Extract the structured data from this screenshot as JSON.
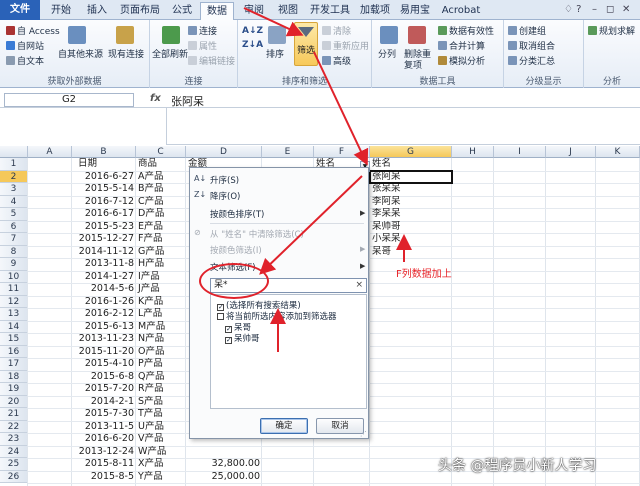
{
  "ribbon": {
    "tabs": [
      "文件",
      "开始",
      "插入",
      "页面布局",
      "公式",
      "数据",
      "审阅",
      "视图",
      "开发工具",
      "加载项",
      "易用宝",
      "Acrobat"
    ],
    "active_tab": "数据",
    "groups": {
      "external": {
        "label": "获取外部数据",
        "items": [
          "自 Access",
          "自网站",
          "自文本",
          "自其他来源",
          "现有连接"
        ]
      },
      "connections": {
        "label": "连接",
        "items": [
          "全部刷新",
          "连接",
          "属性",
          "编辑链接"
        ]
      },
      "sort_filter": {
        "label": "排序和筛选",
        "items": [
          "排序",
          "筛选",
          "清除",
          "重新应用",
          "高级"
        ]
      },
      "data_tools": {
        "label": "数据工具",
        "items": [
          "分列",
          "删除重复项",
          "数据有效性",
          "合并计算",
          "模拟分析"
        ]
      },
      "outline": {
        "label": "分级显示",
        "items": [
          "创建组",
          "取消组合",
          "分类汇总"
        ]
      },
      "analysis": {
        "label": "分析",
        "items": [
          "规划求解"
        ]
      }
    }
  },
  "formula_bar": {
    "name_box": "G2",
    "fx": "fx",
    "value": "张阿呆"
  },
  "sheet": {
    "columns": [
      "A",
      "B",
      "C",
      "D",
      "E",
      "F",
      "G",
      "H",
      "I",
      "J",
      "K"
    ],
    "selected_column": "G",
    "rows": [
      "1",
      "2",
      "3",
      "4",
      "5",
      "6",
      "7",
      "8",
      "9",
      "10",
      "11",
      "12",
      "13",
      "14",
      "15",
      "16",
      "17",
      "18",
      "19",
      "20",
      "21",
      "22",
      "23",
      "24",
      "25",
      "26"
    ],
    "selected_row": "2",
    "headers": {
      "date": "日期",
      "product": "商品",
      "amount": "金额",
      "name": "姓名",
      "gname": "姓名"
    },
    "dates": [
      "2016-6-27",
      "2015-5-14",
      "2016-7-12",
      "2016-6-17",
      "2015-5-23",
      "2015-12-27",
      "2014-11-12",
      "2013-11-8",
      "2014-1-27",
      "2014-5-6",
      "2016-1-26",
      "2016-2-12",
      "2015-6-13",
      "2013-11-23",
      "2015-11-20",
      "2015-4-10",
      "2015-6-8",
      "2015-7-20",
      "2014-2-1",
      "2015-7-30",
      "2013-11-5",
      "2016-6-20",
      "2013-12-24",
      "2015-8-11",
      "2015-8-5"
    ],
    "products": [
      "A产品",
      "B产品",
      "C产品",
      "D产品",
      "E产品",
      "F产品",
      "G产品",
      "H产品",
      "I产品",
      "J产品",
      "K产品",
      "L产品",
      "M产品",
      "N产品",
      "O产品",
      "P产品",
      "Q产品",
      "R产品",
      "S产品",
      "T产品",
      "U产品",
      "V产品",
      "W产品",
      "X产品",
      "Y产品"
    ],
    "amounts_visible": [
      "32,800.00",
      "25,000.00"
    ],
    "g_names": [
      "张阿呆",
      "张呆呆",
      "李阿呆",
      "李呆呆",
      "呆帅哥",
      "小呆呆",
      "呆哥"
    ]
  },
  "filter_menu": {
    "sort_asc": "升序(S)",
    "sort_desc": "降序(O)",
    "sort_color": "按颜色排序(T)",
    "clear_filter": "从 \"姓名\" 中清除筛选(C)",
    "filter_color": "按颜色筛选(I)",
    "text_filter": "文本筛选(F)",
    "search_value": "呆*",
    "search_clear": "×",
    "options": [
      {
        "label": "(选择所有搜索结果)",
        "checked": true
      },
      {
        "label": "将当前所选内容添加到筛选器",
        "checked": false
      },
      {
        "label": "呆哥",
        "checked": true
      },
      {
        "label": "呆帅哥",
        "checked": true
      }
    ],
    "ok": "确定",
    "cancel": "取消"
  },
  "annotation": {
    "note": "F列数据加上"
  },
  "watermark": "头条 @程序员小新人学习",
  "colors": {
    "accent_red": "#e8262b",
    "file_tab": "#2a62b8",
    "selection": "#f5c85a"
  }
}
